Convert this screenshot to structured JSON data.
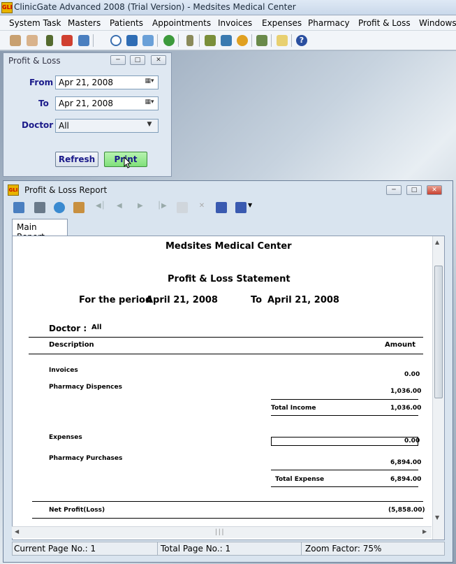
{
  "app": {
    "title": "ClinicGate Advanced 2008 (Trial Version) - Medsites Medical Center",
    "logo_text": "GLI"
  },
  "menu": [
    "System Task",
    "Masters",
    "Patients",
    "Appointments",
    "Invoices",
    "Expenses",
    "Pharmacy",
    "Profit & Loss",
    "Windows"
  ],
  "toolbar_icons": [
    "doctors-icon",
    "patients-icon",
    "appointments-icon",
    "invoices-icon",
    "treatments-icon",
    "clock-icon",
    "book-icon",
    "report-icon",
    "money-icon",
    "dice-icon",
    "pharmacy-icon",
    "chain-icon",
    "pills-icon",
    "purchase-icon",
    "tools-icon",
    "help-icon"
  ],
  "pl_dialog": {
    "title": "Profit & Loss",
    "from_label": "From",
    "from_value": "Apr 21, 2008",
    "to_label": "To",
    "to_value": "Apr 21, 2008",
    "doctor_label": "Doctor",
    "doctor_value": "All",
    "refresh_label": "Refresh",
    "print_label": "Print"
  },
  "report_window": {
    "title": "Profit & Loss Report",
    "tab_label": "Main Report",
    "icon_text": "GLI"
  },
  "report": {
    "company": "Medsites Medical Center",
    "heading": "Profit & Loss Statement",
    "period_prefix": "For the period",
    "period_from": "April 21, 2008",
    "period_to_label": "To",
    "period_to": "April 21, 2008",
    "doctor_label": "Doctor :",
    "doctor_value": "All",
    "col_description": "Description",
    "col_amount": "Amount",
    "invoices_label": "Invoices",
    "invoices_value": "0.00",
    "pharmacy_disp_label": "Pharmacy Dispences",
    "pharmacy_disp_value": "1,036.00",
    "total_income_label": "Total Income",
    "total_income_value": "1,036.00",
    "expenses_label": "Expenses",
    "expenses_value": "0.00",
    "pharmacy_purch_label": "Pharmacy Purchases",
    "pharmacy_purch_value": "6,894.00",
    "total_expense_label": "Total Expense",
    "total_expense_value": "6,894.00",
    "net_label": "Net Profit(Loss)",
    "net_value": "(5,858.00)"
  },
  "status": {
    "current_page": "Current Page No.: 1",
    "total_page": "Total Page No.: 1",
    "zoom": "Zoom Factor: 75%"
  }
}
